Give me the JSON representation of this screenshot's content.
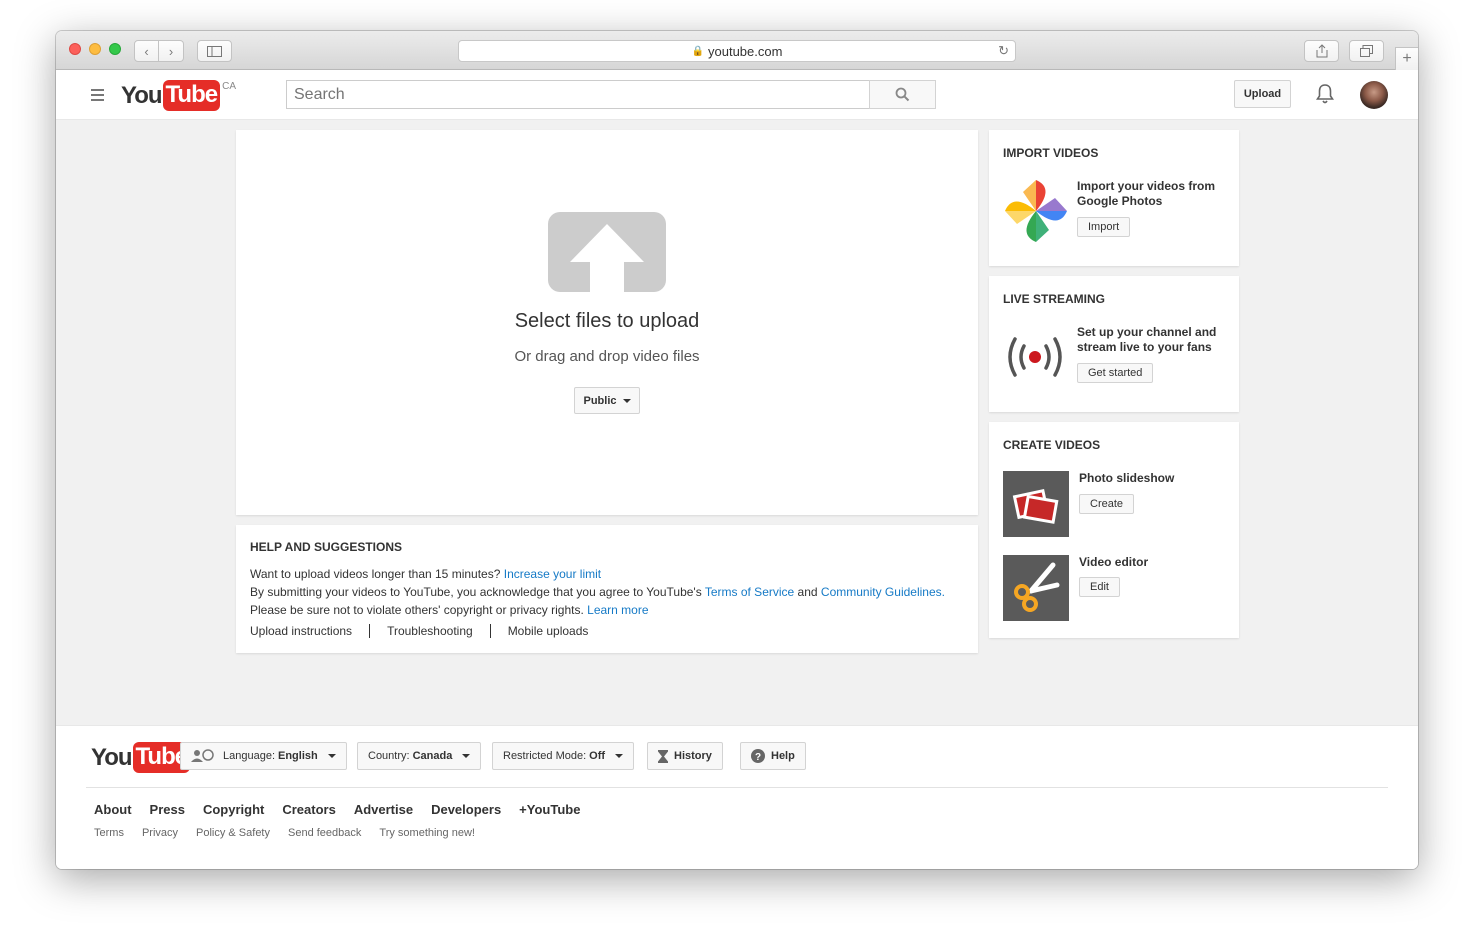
{
  "browser": {
    "url": "youtube.com"
  },
  "header": {
    "logo_you": "You",
    "logo_tube": "Tube",
    "region": "CA",
    "search_placeholder": "Search",
    "upload_label": "Upload"
  },
  "upload": {
    "title": "Select files to upload",
    "subtitle": "Or drag and drop video files",
    "privacy_value": "Public"
  },
  "help": {
    "title": "HELP AND SUGGESTIONS",
    "line1_text": "Want to upload videos longer than 15 minutes?",
    "line1_link": "Increase your limit",
    "line2_text_a": "By submitting your videos to YouTube, you acknowledge that you agree to YouTube's",
    "line2_link_a": "Terms of Service",
    "line2_text_b": "and",
    "line2_link_b": "Community Guidelines",
    "line2_text_c": ".",
    "line3_text": "Please be sure not to violate others' copyright or privacy rights.",
    "line3_link": "Learn more",
    "links": [
      "Upload instructions",
      "Troubleshooting",
      "Mobile uploads"
    ]
  },
  "import": {
    "title": "IMPORT VIDEOS",
    "desc": "Import your videos from Google Photos",
    "button": "Import"
  },
  "live": {
    "title": "LIVE STREAMING",
    "desc": "Set up your channel and stream live to your fans",
    "button": "Get started"
  },
  "create": {
    "title": "CREATE VIDEOS",
    "slideshow_label": "Photo slideshow",
    "slideshow_button": "Create",
    "editor_label": "Video editor",
    "editor_button": "Edit"
  },
  "footer": {
    "language_label": "Language:",
    "language_value": "English",
    "country_label": "Country:",
    "country_value": "Canada",
    "restricted_label": "Restricted Mode:",
    "restricted_value": "Off",
    "history_label": "History",
    "help_label": "Help",
    "primary_links": [
      "About",
      "Press",
      "Copyright",
      "Creators",
      "Advertise",
      "Developers",
      "+YouTube"
    ],
    "secondary_links": [
      "Terms",
      "Privacy",
      "Policy & Safety",
      "Send feedback",
      "Try something new!"
    ]
  },
  "colors": {
    "youtube_red": "#e52d27",
    "link_blue": "#167ac6",
    "background": "#f1f1f1"
  }
}
